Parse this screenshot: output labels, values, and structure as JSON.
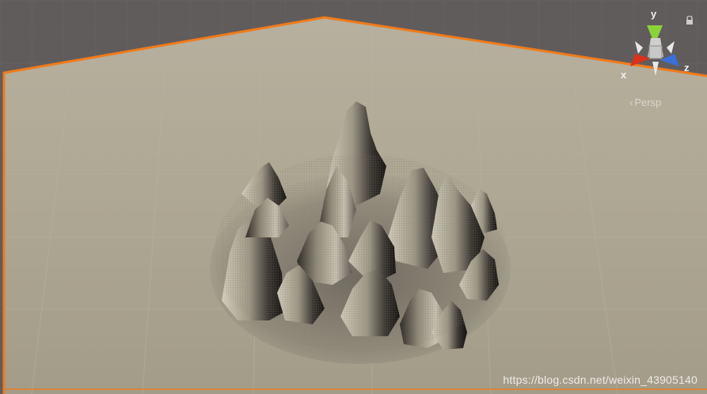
{
  "gizmo": {
    "y_label": "y",
    "x_label": "x",
    "z_label": "z",
    "colors": {
      "y": "#8ad33a",
      "x": "#d8321e",
      "z": "#3a6fd8",
      "center": "#c8c8c8"
    }
  },
  "projection": {
    "label": "Persp"
  },
  "lock_icon": "lock-icon",
  "watermark": "https://blog.csdn.net/weixin_43905140",
  "colors": {
    "background": "#615c5c",
    "ground": "#a8a18f",
    "selection_outline": "#f07b1a",
    "terrain_light": "#d4cebe",
    "terrain_shadow": "#1f1d1a"
  }
}
